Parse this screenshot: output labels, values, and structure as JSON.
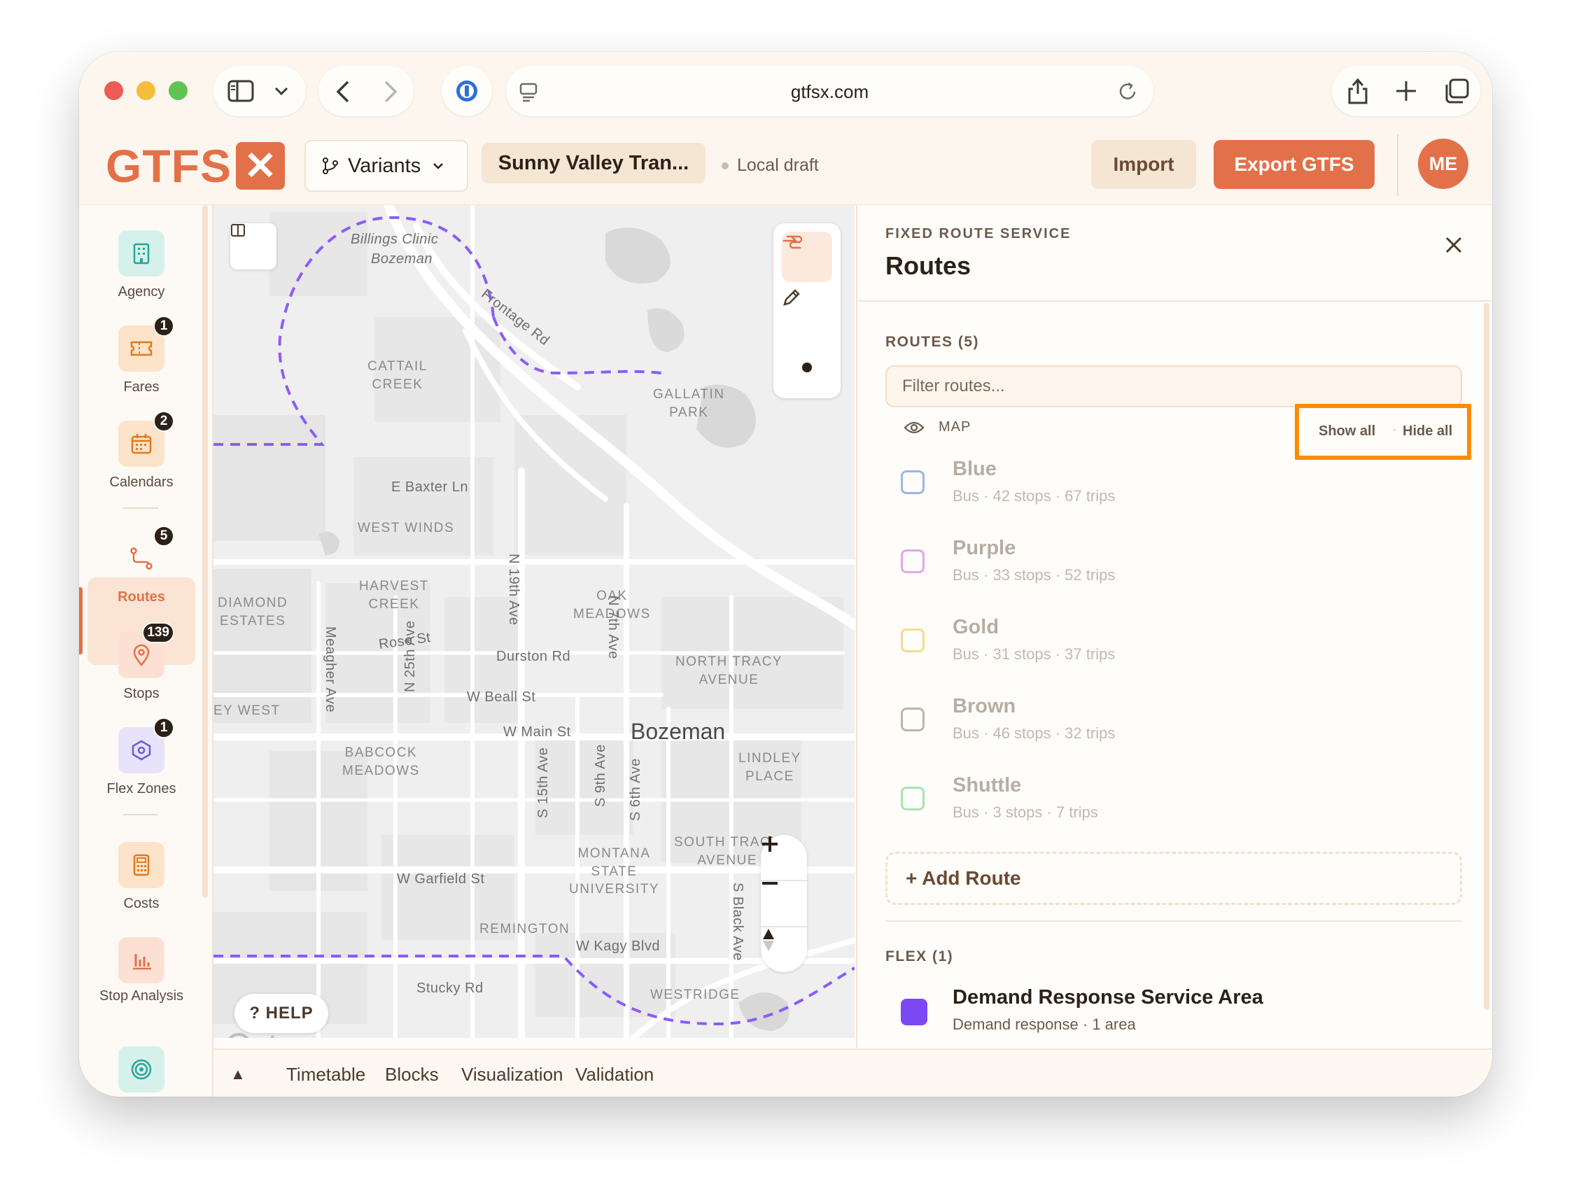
{
  "browser": {
    "url": "gtfsx.com"
  },
  "header": {
    "logo_text": "GTFS",
    "logo_mark": "✕",
    "variants_label": "Variants",
    "agency_name": "Sunny Valley Tran...",
    "draft_status": "Local draft",
    "import_label": "Import",
    "export_label": "Export GTFS",
    "avatar_initials": "ME"
  },
  "sidebar": {
    "items": [
      {
        "label": "Agency",
        "icon": "building-icon",
        "badge": ""
      },
      {
        "label": "Fares",
        "icon": "ticket-icon",
        "badge": "1"
      },
      {
        "label": "Calendars",
        "icon": "calendar-icon",
        "badge": "2"
      },
      {
        "label": "Routes",
        "icon": "route-icon",
        "badge": "5"
      },
      {
        "label": "Stops",
        "icon": "map-pin-icon",
        "badge": "139"
      },
      {
        "label": "Flex Zones",
        "icon": "hexagon-icon",
        "badge": "1"
      },
      {
        "label": "Costs",
        "icon": "calculator-icon",
        "badge": ""
      },
      {
        "label": "Stop Analysis",
        "icon": "bar-chart-icon",
        "badge": ""
      },
      {
        "label": "",
        "icon": "target-icon",
        "badge": ""
      }
    ],
    "active_item": "Routes"
  },
  "map": {
    "labels": {
      "billings": "Billings Clinic",
      "bozeman_sub": "Bozeman",
      "frontage": "Frontage Rd",
      "cattail": "CATTAIL\nCREEK",
      "gallatin": "GALLATIN\nPARK",
      "baxter": "E Baxter Ln",
      "westwinds": "WEST WINDS",
      "harvest": "HARVEST\nCREEK",
      "diamond": "DIAMOND\nESTATES",
      "oak": "OAK\nMEADOWS",
      "n19": "N 19th Ave",
      "n7": "N 7th Ave",
      "rose": "Rose St",
      "meagher": "Meagher Ave",
      "n25": "N 25th Ave",
      "durston": "Durston Rd",
      "northtracy": "NORTH TRACY\nAVENUE",
      "beall": "W Beall St",
      "valleywest": "EY WEST",
      "main": "W Main St",
      "city": "Bozeman",
      "lindley": "LINDLEY\nPLACE",
      "babcock": "BABCOCK\nMEADOWS",
      "s15": "S 15th Ave",
      "s9": "S 9th Ave",
      "s6": "S 6th Ave",
      "montana": "MONTANA\nSTATE\nUNIVERSITY",
      "southtracy": "SOUTH TRACY\nAVENUE",
      "garfield": "W Garfield St",
      "sblack": "S Black Ave",
      "remington": "REMINGTON",
      "kagy": "W Kagy Blvd",
      "stucky": "Stucky Rd",
      "westridge": "WESTRIDGE"
    },
    "help_label": "? HELP",
    "attribution": "mapbox",
    "tools": [
      "pan-hand-icon",
      "pencil-icon",
      "point-icon"
    ],
    "route_line_color": "#8b5cf6"
  },
  "bottom_tabs": {
    "toggle": "▲",
    "items": [
      "Timetable",
      "Blocks",
      "Visualization",
      "Validation"
    ]
  },
  "panel": {
    "kicker": "FIXED ROUTE SERVICE",
    "title": "Routes",
    "routes_heading": "ROUTES (5)",
    "filter_placeholder": "Filter routes...",
    "map_toggle_label": "MAP",
    "show_all": "Show all",
    "hide_all": "Hide all",
    "routes": [
      {
        "name": "Blue",
        "meta": "Bus · 42 stops · 67 trips",
        "color": "#9fb3e6"
      },
      {
        "name": "Purple",
        "meta": "Bus · 33 stops · 52 trips",
        "color": "#e4a6e8"
      },
      {
        "name": "Gold",
        "meta": "Bus · 31 stops · 37 trips",
        "color": "#f1dc8f"
      },
      {
        "name": "Brown",
        "meta": "Bus · 46 stops · 32 trips",
        "color": "#c2b3a4"
      },
      {
        "name": "Shuttle",
        "meta": "Bus · 3 stops · 7 trips",
        "color": "#a8e4b0"
      }
    ],
    "add_route_label": "+ Add Route",
    "flex_heading": "FLEX (1)",
    "flex_item": {
      "name": "Demand Response Service Area",
      "meta": "Demand response · 1 area",
      "color": "#7c48f2"
    },
    "highlight_color": "#fb8c00"
  }
}
